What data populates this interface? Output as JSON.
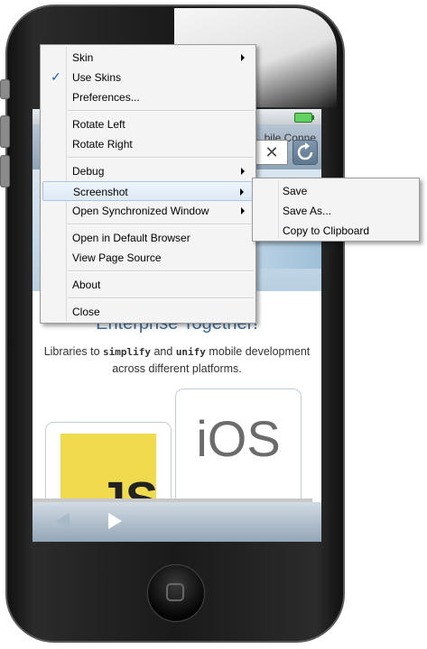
{
  "screen": {
    "page_title_partial": "bile Conne",
    "url_clear_glyph": "✕",
    "headline": "Enterprise Together!",
    "subtext_pre": "Libraries to ",
    "subtext_simplify": "simplify",
    "subtext_mid": " and ",
    "subtext_unify": "unify",
    "subtext_post": " mobile development across different platforms.",
    "js_logo_text": "JS",
    "ios_logo_text": "iOS"
  },
  "context_menu": {
    "items": [
      {
        "label": "Skin"
      },
      {
        "label": "Use Skins",
        "checkmark": "✓"
      },
      {
        "label": "Preferences..."
      },
      {
        "label": "Rotate Left"
      },
      {
        "label": "Rotate Right"
      },
      {
        "label": "Debug"
      },
      {
        "label": "Screenshot"
      },
      {
        "label": "Open Synchronized Window"
      },
      {
        "label": "Open in Default Browser"
      },
      {
        "label": "View Page Source"
      },
      {
        "label": "About"
      },
      {
        "label": "Close"
      }
    ]
  },
  "screenshot_submenu": {
    "items": [
      {
        "label": "Save"
      },
      {
        "label": "Save As..."
      },
      {
        "label": "Copy to Clipboard"
      }
    ]
  },
  "colors": {
    "accent_check": "#1f5fb8",
    "highlight": "#dde9f6",
    "headline": "#3f6e99",
    "js_yellow": "#f0db4f"
  }
}
